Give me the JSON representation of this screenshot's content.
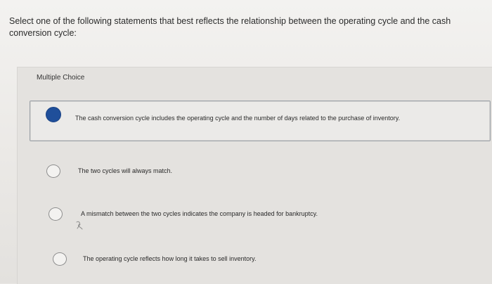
{
  "question": {
    "text": "Select one of the following statements that best reflects the relationship between the operating cycle and the cash conversion cycle:"
  },
  "multiple_choice": {
    "label": "Multiple Choice",
    "options": [
      {
        "text": "The cash conversion cycle includes the operating cycle and the number of days related to the purchase of inventory.",
        "selected": true
      },
      {
        "text": "The two cycles will always match.",
        "selected": false
      },
      {
        "text": "A mismatch between the two cycles indicates the company is headed for bankruptcy.",
        "selected": false
      },
      {
        "text": "The operating cycle reflects how long it takes to sell inventory.",
        "selected": false
      }
    ]
  },
  "colors": {
    "selected_radio": "#1f4f9a",
    "unselected_radio_border": "#8e8e8e",
    "selected_option_border": "#9aa0a6"
  }
}
